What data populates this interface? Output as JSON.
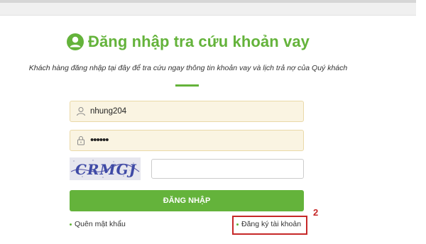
{
  "header": {
    "title": "Đăng nhập tra cứu khoản vay",
    "subtitle": "Khách hàng đăng nhập tại đây để tra cứu ngay thông tin khoản vay và lịch trả nợ của Quý khách",
    "icon": "user-circle-icon"
  },
  "form": {
    "username": {
      "value": "nhung204",
      "icon": "user-icon"
    },
    "password": {
      "value": "••••••",
      "icon": "lock-icon"
    },
    "captcha": {
      "text": "CRMGJ",
      "input_value": ""
    },
    "login_label": "ĐĂNG NHẬP"
  },
  "links": {
    "forgot_password": "Quên mật khẩu",
    "register": "Đăng ký tài khoản"
  },
  "annotation": {
    "step": "2"
  },
  "colors": {
    "brand_green": "#64b33b",
    "highlight_red": "#c62828",
    "field_bg": "#faf4e2"
  }
}
